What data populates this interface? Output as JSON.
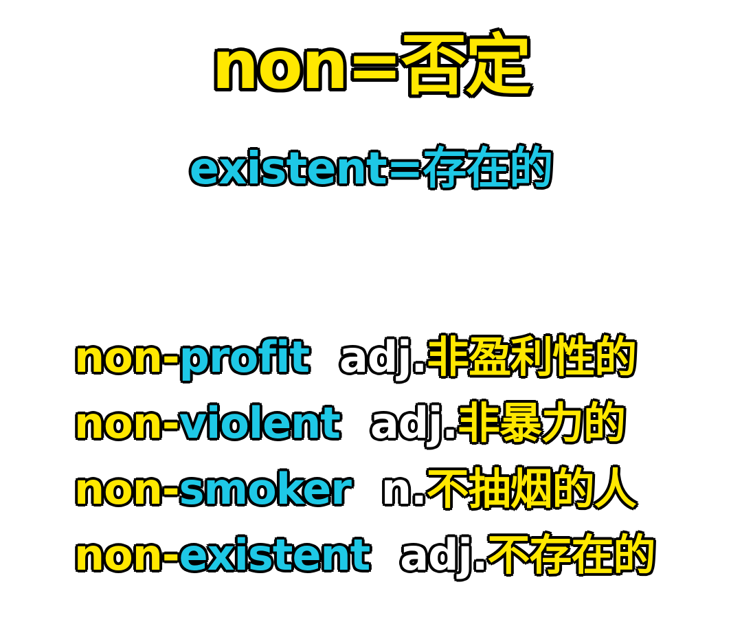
{
  "header": {
    "title": "non=否定",
    "subtitle": "existent=存在的"
  },
  "words": [
    {
      "prefix": "non-",
      "root": "profit",
      "pos": "adj.",
      "meaning": "非盈利性的"
    },
    {
      "prefix": "non-",
      "root": "violent",
      "pos": "adj.",
      "meaning": "非暴力的"
    },
    {
      "prefix": "non-",
      "root": "smoker",
      "pos": "n.",
      "meaning": "不抽烟的人"
    },
    {
      "prefix": "non-",
      "root": "existent",
      "pos": "adj.",
      "meaning": "不存在的"
    }
  ],
  "colors": {
    "yellow": "#ffe800",
    "cyan": "#1ec8e6",
    "white": "#ffffff",
    "outline": "#000000"
  }
}
